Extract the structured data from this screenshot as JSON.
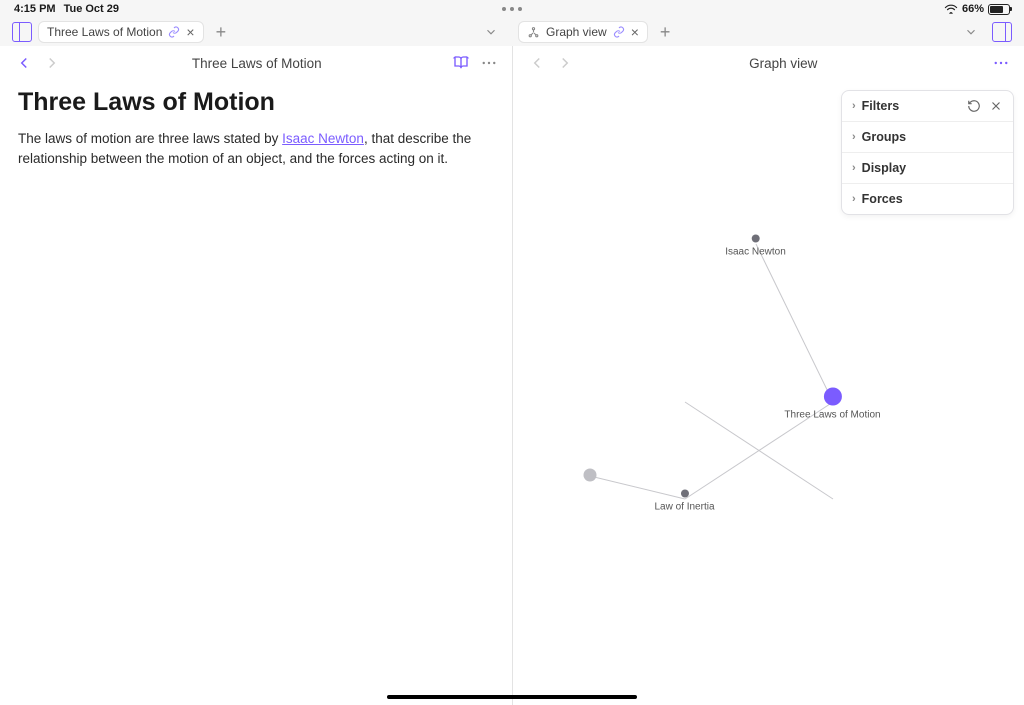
{
  "status": {
    "time": "4:15 PM",
    "date": "Tue Oct 29",
    "battery": "66%"
  },
  "tabs": {
    "left": {
      "title": "Three Laws of Motion"
    },
    "right": {
      "title": "Graph view"
    }
  },
  "pane_left": {
    "title": "Three Laws of Motion",
    "note_title": "Three Laws of Motion",
    "body_pre": "The laws of motion are three laws stated by ",
    "body_link": "Isaac Newton",
    "body_post": ", that describe the relationship between the motion of an object, and the forces acting on it."
  },
  "pane_right": {
    "title": "Graph view"
  },
  "settings": {
    "rows": [
      "Filters",
      "Groups",
      "Display",
      "Forces"
    ]
  },
  "graph": {
    "nodes": {
      "newton": {
        "label": "Isaac Newton"
      },
      "three_laws": {
        "label": "Three Laws of Motion"
      },
      "inertia": {
        "label": "Law of Inertia"
      }
    }
  }
}
